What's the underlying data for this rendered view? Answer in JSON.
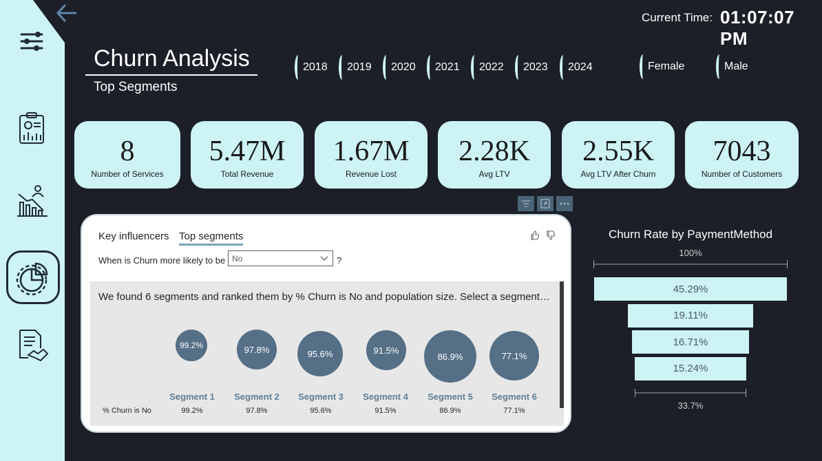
{
  "header": {
    "current_time_label": "Current Time:",
    "current_time_value": "01:07:07 PM",
    "title": "Churn Analysis",
    "subtitle": "Top Segments"
  },
  "sidebar": {
    "items": [
      {
        "icon": "filter-sliders-icon"
      },
      {
        "icon": "report-clipboard-icon"
      },
      {
        "icon": "declining-customers-chart-icon"
      },
      {
        "icon": "pie-gear-icon",
        "active": true
      },
      {
        "icon": "contract-handshake-icon"
      }
    ]
  },
  "year_slicer": [
    "2018",
    "2019",
    "2020",
    "2021",
    "2022",
    "2023",
    "2024"
  ],
  "gender_slicer": [
    "Female",
    "Male"
  ],
  "kpis": [
    {
      "value": "8",
      "label": "Number of Services"
    },
    {
      "value": "5.47M",
      "label": "Total Revenue"
    },
    {
      "value": "1.67M",
      "label": "Revenue Lost"
    },
    {
      "value": "2.28K",
      "label": "Avg LTV"
    },
    {
      "value": "2.55K",
      "label": "Avg LTV After Churn"
    },
    {
      "value": "7043",
      "label": "Number of Customers"
    }
  ],
  "top_segments": {
    "tabs": [
      "Key influencers",
      "Top segments"
    ],
    "active_tab": "Top segments",
    "question_label": "When is Churn more likely to be",
    "selected_value": "No",
    "question_suffix": "?",
    "summary": "We found 6 segments and ranked them by % Churn is No and population size. Select a segment t...",
    "row_label": "% Churn is No",
    "segments": [
      {
        "name": "Segment 1",
        "pct": "99.2%"
      },
      {
        "name": "Segment 2",
        "pct": "97.8%"
      },
      {
        "name": "Segment 3",
        "pct": "95.6%"
      },
      {
        "name": "Segment 4",
        "pct": "91.5%"
      },
      {
        "name": "Segment 5",
        "pct": "86.9%"
      },
      {
        "name": "Segment 6",
        "pct": "77.1%"
      }
    ]
  },
  "funnel": {
    "title": "Churn Rate by PaymentMethod",
    "top_pct": "100%",
    "bottom_pct": "33.7%",
    "bars": [
      {
        "label": "45.29%",
        "value": 45.29
      },
      {
        "label": "19.11%",
        "value": 19.11
      },
      {
        "label": "16.71%",
        "value": 16.71
      },
      {
        "label": "15.24%",
        "value": 15.24
      }
    ]
  },
  "colors": {
    "background": "#1c1f27",
    "accent": "#cdf3f5",
    "bubble": "#546f86"
  }
}
